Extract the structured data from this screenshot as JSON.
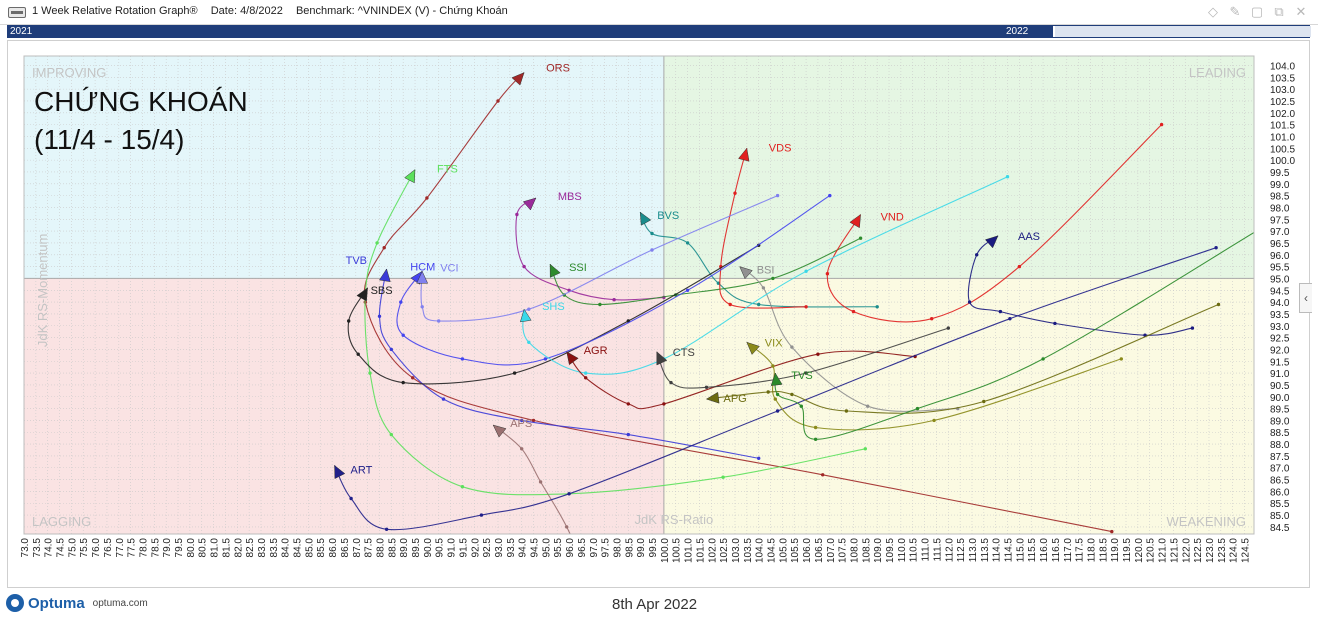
{
  "window": {
    "title_parts": [
      "1 Week Relative Rotation Graph®",
      "Date: 4/8/2022",
      "Benchmark:  ^VNINDEX (V) - Chứng Khoán"
    ]
  },
  "timeline": {
    "start_label": "2021",
    "end_label": "2022"
  },
  "footer": {
    "brand": "Optuma",
    "url": "optuma.com",
    "date": "8th Apr 2022"
  },
  "chart_data": {
    "type": "scatter",
    "title": "CHỨNG KHOÁN",
    "subtitle": "(11/4 - 15/4)",
    "xlabel": "JdK RS-Ratio",
    "ylabel": "JdK RS-Momentum",
    "xlim": [
      73.0,
      124.9
    ],
    "ylim": [
      84.2,
      104.4
    ],
    "x_tick_start": 73.0,
    "x_tick_end": 124.5,
    "x_tick_step": 0.5,
    "y_tick_start": 84.5,
    "y_tick_end": 104.0,
    "y_tick_step": 0.5,
    "center": [
      100,
      95
    ],
    "grid": true,
    "quadrants": [
      {
        "name": "IMPROVING",
        "color": "#e4f6fa"
      },
      {
        "name": "LEADING",
        "color": "#e5f6e3"
      },
      {
        "name": "LAGGING",
        "color": "#fae3e3"
      },
      {
        "name": "WEAKENING",
        "color": "#fbfae2"
      }
    ],
    "series": [
      {
        "name": "ORS",
        "color": "#a02828",
        "points": [
          [
            118.9,
            84.3
          ],
          [
            106.7,
            86.7
          ],
          [
            94.5,
            89.0
          ],
          [
            89.4,
            90.8
          ],
          [
            87.4,
            94.0
          ],
          [
            88.2,
            96.3
          ],
          [
            90.0,
            98.4
          ],
          [
            93.0,
            102.5
          ],
          [
            94.1,
            103.7
          ]
        ]
      },
      {
        "name": "FTS",
        "color": "#5ce05c",
        "points": [
          [
            108.5,
            87.8
          ],
          [
            102.5,
            86.6
          ],
          [
            96.0,
            85.9
          ],
          [
            91.5,
            86.2
          ],
          [
            88.5,
            88.4
          ],
          [
            87.6,
            91.0
          ],
          [
            87.4,
            94.3
          ],
          [
            87.9,
            96.5
          ],
          [
            89.5,
            99.6
          ]
        ]
      },
      {
        "name": "MBS",
        "color": "#9a2a9a",
        "points": [
          [
            100.0,
            94.2
          ],
          [
            97.9,
            94.1
          ],
          [
            96.0,
            94.5
          ],
          [
            94.1,
            95.5
          ],
          [
            93.8,
            97.7
          ],
          [
            94.6,
            98.4
          ]
        ]
      },
      {
        "name": "BVS",
        "color": "#1a8c8c",
        "points": [
          [
            109.0,
            93.8
          ],
          [
            104.0,
            93.9
          ],
          [
            102.3,
            94.8
          ],
          [
            101.0,
            96.5
          ],
          [
            99.5,
            96.9
          ],
          [
            99.0,
            97.8
          ]
        ]
      },
      {
        "name": "SSI",
        "color": "#2e8b2e",
        "points": [
          [
            108.3,
            96.7
          ],
          [
            104.6,
            95.0
          ],
          [
            100.5,
            94.3
          ],
          [
            97.3,
            93.9
          ],
          [
            95.8,
            94.3
          ],
          [
            95.2,
            95.6
          ]
        ]
      },
      {
        "name": "BSI",
        "color": "#909090",
        "points": [
          [
            112.4,
            89.5
          ],
          [
            108.6,
            89.6
          ],
          [
            105.4,
            92.1
          ],
          [
            104.2,
            94.6
          ],
          [
            103.2,
            95.5
          ]
        ]
      },
      {
        "name": "VDS",
        "color": "#e02020",
        "points": [
          [
            106.0,
            93.8
          ],
          [
            102.8,
            93.9
          ],
          [
            102.4,
            95.5
          ],
          [
            103.0,
            98.6
          ],
          [
            103.5,
            100.5
          ]
        ]
      },
      {
        "name": "VND",
        "color": "#e02020",
        "points": [
          [
            121.0,
            101.5
          ],
          [
            115.0,
            95.5
          ],
          [
            111.3,
            93.3
          ],
          [
            108.0,
            93.6
          ],
          [
            106.9,
            95.2
          ],
          [
            108.3,
            97.7
          ]
        ]
      },
      {
        "name": "AAS",
        "color": "#1a1a80",
        "points": [
          [
            122.3,
            92.9
          ],
          [
            120.3,
            92.6
          ],
          [
            116.5,
            93.1
          ],
          [
            114.2,
            93.6
          ],
          [
            112.9,
            94.0
          ],
          [
            113.2,
            96.0
          ],
          [
            114.1,
            96.8
          ]
        ]
      },
      {
        "name": "TVB",
        "color": "#3a3ad8",
        "points": [
          [
            104.0,
            87.4
          ],
          [
            98.5,
            88.4
          ],
          [
            94.0,
            89.0
          ],
          [
            90.7,
            89.9
          ],
          [
            88.5,
            92.0
          ],
          [
            88.0,
            93.4
          ],
          [
            88.3,
            95.4
          ]
        ]
      },
      {
        "name": "SBS",
        "color": "#222222",
        "points": [
          [
            104.0,
            96.4
          ],
          [
            98.5,
            93.2
          ],
          [
            93.7,
            91.0
          ],
          [
            89.0,
            90.6
          ],
          [
            87.1,
            91.8
          ],
          [
            86.7,
            93.2
          ],
          [
            87.5,
            94.6
          ]
        ]
      },
      {
        "name": "HCM",
        "color": "#4444ee",
        "points": [
          [
            107.0,
            98.5
          ],
          [
            101.0,
            94.5
          ],
          [
            95.0,
            91.6
          ],
          [
            91.5,
            91.6
          ],
          [
            89.0,
            92.6
          ],
          [
            88.9,
            94.0
          ],
          [
            89.8,
            95.3
          ]
        ]
      },
      {
        "name": "VCI",
        "color": "#8080ee",
        "points": [
          [
            104.8,
            98.5
          ],
          [
            99.5,
            96.2
          ],
          [
            94.3,
            93.7
          ],
          [
            90.5,
            93.2
          ],
          [
            89.8,
            93.8
          ],
          [
            89.8,
            95.3
          ]
        ]
      },
      {
        "name": "SHS",
        "color": "#3ad8e8",
        "points": [
          [
            114.5,
            99.3
          ],
          [
            106.0,
            95.3
          ],
          [
            100.0,
            91.6
          ],
          [
            96.7,
            91.0
          ],
          [
            94.3,
            92.3
          ],
          [
            94.1,
            93.7
          ]
        ]
      },
      {
        "name": "AGR",
        "color": "#8a1010",
        "points": [
          [
            110.6,
            91.7
          ],
          [
            106.5,
            91.8
          ],
          [
            100.0,
            89.7
          ],
          [
            98.5,
            89.7
          ],
          [
            96.7,
            90.8
          ],
          [
            95.9,
            91.9
          ]
        ]
      },
      {
        "name": "CTS",
        "color": "#404040",
        "points": [
          [
            112.0,
            92.9
          ],
          [
            106.0,
            91.0
          ],
          [
            101.8,
            90.4
          ],
          [
            100.3,
            90.6
          ],
          [
            99.7,
            91.9
          ]
        ]
      },
      {
        "name": "APS",
        "color": "#9a7070",
        "points": [
          [
            97.0,
            82.0
          ],
          [
            95.9,
            84.5
          ],
          [
            94.8,
            86.4
          ],
          [
            94.0,
            87.8
          ],
          [
            92.8,
            88.8
          ]
        ]
      },
      {
        "name": "ART",
        "color": "#20208a",
        "points": [
          [
            123.3,
            96.3
          ],
          [
            114.6,
            93.3
          ],
          [
            104.8,
            89.4
          ],
          [
            96.0,
            85.9
          ],
          [
            92.3,
            85.0
          ],
          [
            88.3,
            84.4
          ],
          [
            86.8,
            85.7
          ],
          [
            86.1,
            87.1
          ]
        ]
      },
      {
        "name": "VIX",
        "color": "#8a8a1a",
        "points": [
          [
            119.3,
            91.6
          ],
          [
            111.4,
            89.0
          ],
          [
            106.4,
            88.7
          ],
          [
            104.7,
            89.9
          ],
          [
            104.6,
            91.3
          ],
          [
            103.5,
            92.3
          ]
        ]
      },
      {
        "name": "APG",
        "color": "#6b6b10",
        "points": [
          [
            123.4,
            93.9
          ],
          [
            113.5,
            89.8
          ],
          [
            107.7,
            89.4
          ],
          [
            105.4,
            90.1
          ],
          [
            104.4,
            90.2
          ],
          [
            101.8,
            89.9
          ]
        ]
      },
      {
        "name": "TVS",
        "color": "#2a8a2a",
        "points": [
          [
            125.0,
            97.0
          ],
          [
            116.0,
            91.6
          ],
          [
            110.7,
            89.5
          ],
          [
            106.4,
            88.2
          ],
          [
            105.8,
            89.6
          ],
          [
            104.8,
            90.1
          ],
          [
            104.7,
            91.0
          ]
        ]
      }
    ]
  }
}
